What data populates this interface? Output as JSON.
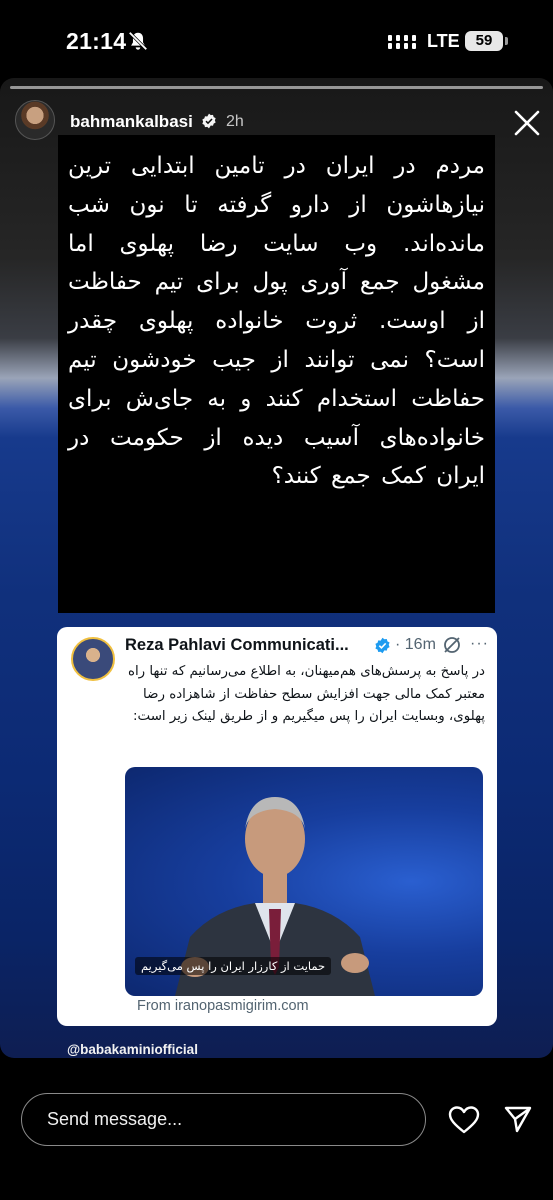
{
  "status_bar": {
    "time": "21:14",
    "network": "LTE",
    "battery": "59",
    "icons": [
      "bell-muted-icon",
      "signal-icon"
    ]
  },
  "story": {
    "username": "bahmankalbasi",
    "time_ago": "2h",
    "text": "مردم در ایران در تامین ابتدایی ترین نیازهاشون از دارو گرفته تا نون شب مانده‌اند. وب سایت رضا پهلوی اما مشغول جمع آوری پول برای تیم حفاظت از اوست. ثروت خانواده پهلوی چقدر است؟ نمی توانند از جیب خودشون تیم حفاظت استخدام کنند و به جای‌ش برای خانواده‌های آسیب دیده از حکومت در ایران کمک جمع کنند؟",
    "credit": "@babakaminiofficial",
    "icons": [
      "verified-badge-icon",
      "close-icon"
    ]
  },
  "tweet": {
    "author": "Reza Pahlavi Communicati...",
    "time": "16m",
    "more": "···",
    "body": "در پاسخ به پرسش‌های هم‌میهنان، به اطلاع می‌رسانیم که تنها راه معتبر کمک مالی جهت افزایش سطح حفاظت از شاهزاده رضا پهلوی، وبسایت ایران را پس میگیریم و از طریق لینک زیر است:",
    "media_caption": "حمایت از کارزار ایران را پس می‌گیریم",
    "link": "From iranopasmigirim.com",
    "icons": [
      "verified-badge-icon",
      "grok-icon",
      "more-icon"
    ]
  },
  "bottom_bar": {
    "message_placeholder": "Send message...",
    "icons": [
      "heart-icon",
      "send-icon"
    ]
  }
}
